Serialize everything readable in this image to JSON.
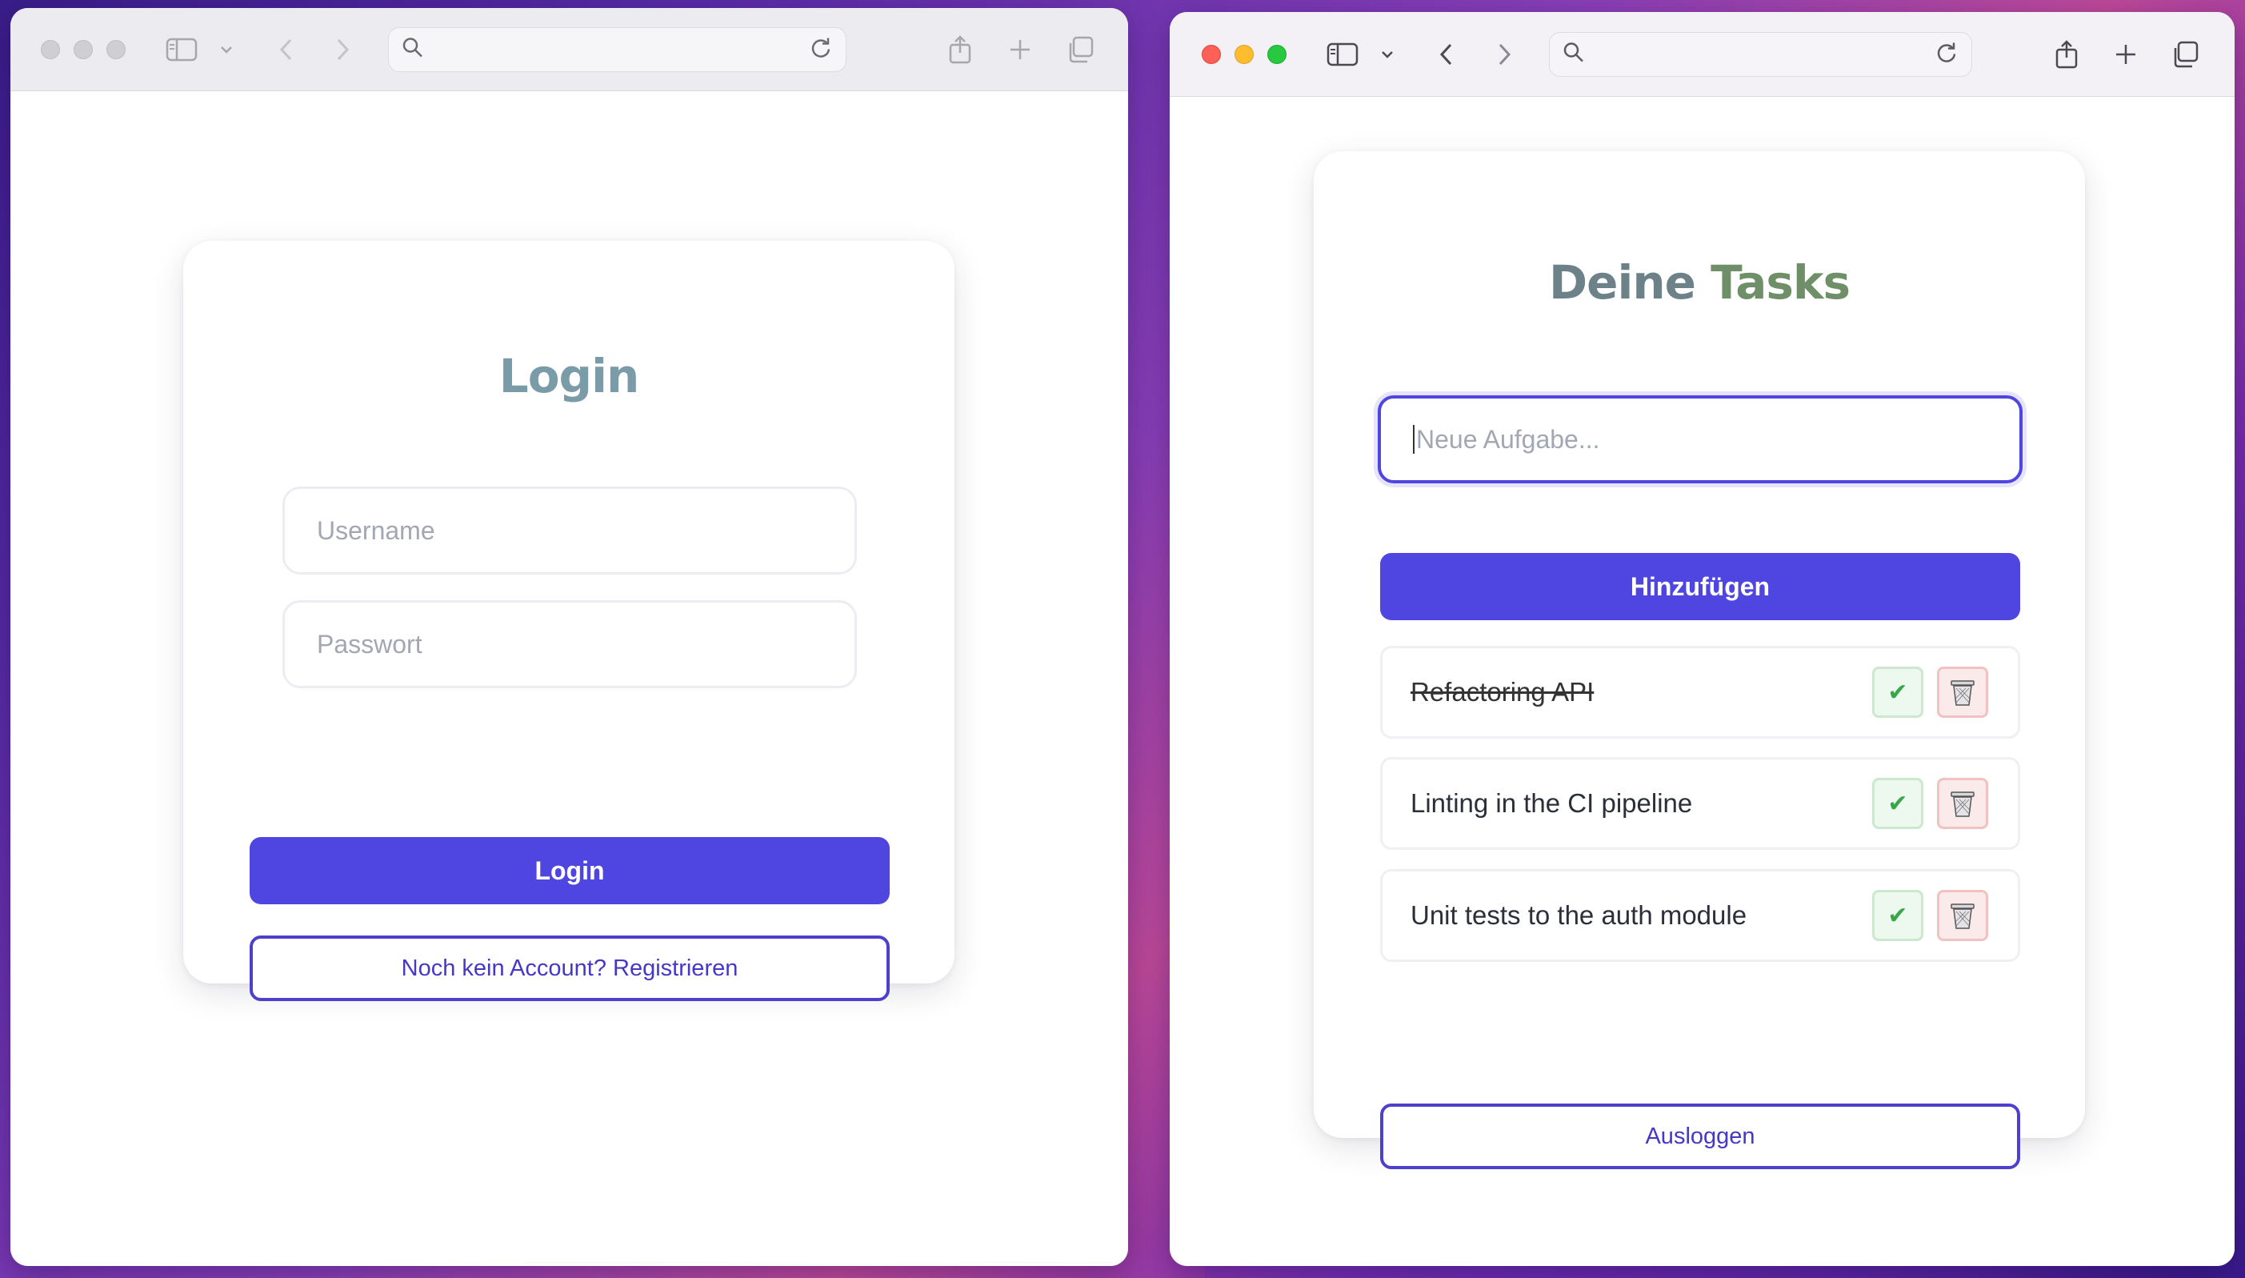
{
  "login_window": {
    "login_card": {
      "title": "Login",
      "username_placeholder": "Username",
      "password_placeholder": "Passwort",
      "login_button": "Login",
      "register_button": "Noch kein Account? Registrieren"
    }
  },
  "tasks_window": {
    "tasks_card": {
      "title_part1": "Deine",
      "title_part2": "Tasks",
      "new_task_placeholder": "Neue Aufgabe...",
      "add_button": "Hinzufügen",
      "tasks": [
        {
          "text": "Refactoring API",
          "done": true
        },
        {
          "text": "Linting in the CI pipeline",
          "done": false
        },
        {
          "text": "Unit tests to the auth module",
          "done": false
        }
      ],
      "complete_icon": "✔",
      "logout_button": "Ausloggen"
    }
  },
  "colors": {
    "primary": "#4f46e1",
    "outline": "#4d40cf",
    "login_title": "#7a9ba8",
    "title_deine": "#6d8288",
    "title_tasks": "#6e8f68",
    "check_green": "#3aa64a",
    "delete_red": "#f1c2c2"
  },
  "icons": [
    "sidebar-icon",
    "chevron-down-icon",
    "back-icon",
    "forward-icon",
    "search-icon",
    "reload-icon",
    "share-icon",
    "new-tab-icon",
    "tabs-overview-icon",
    "checkmark-icon",
    "trash-icon"
  ]
}
